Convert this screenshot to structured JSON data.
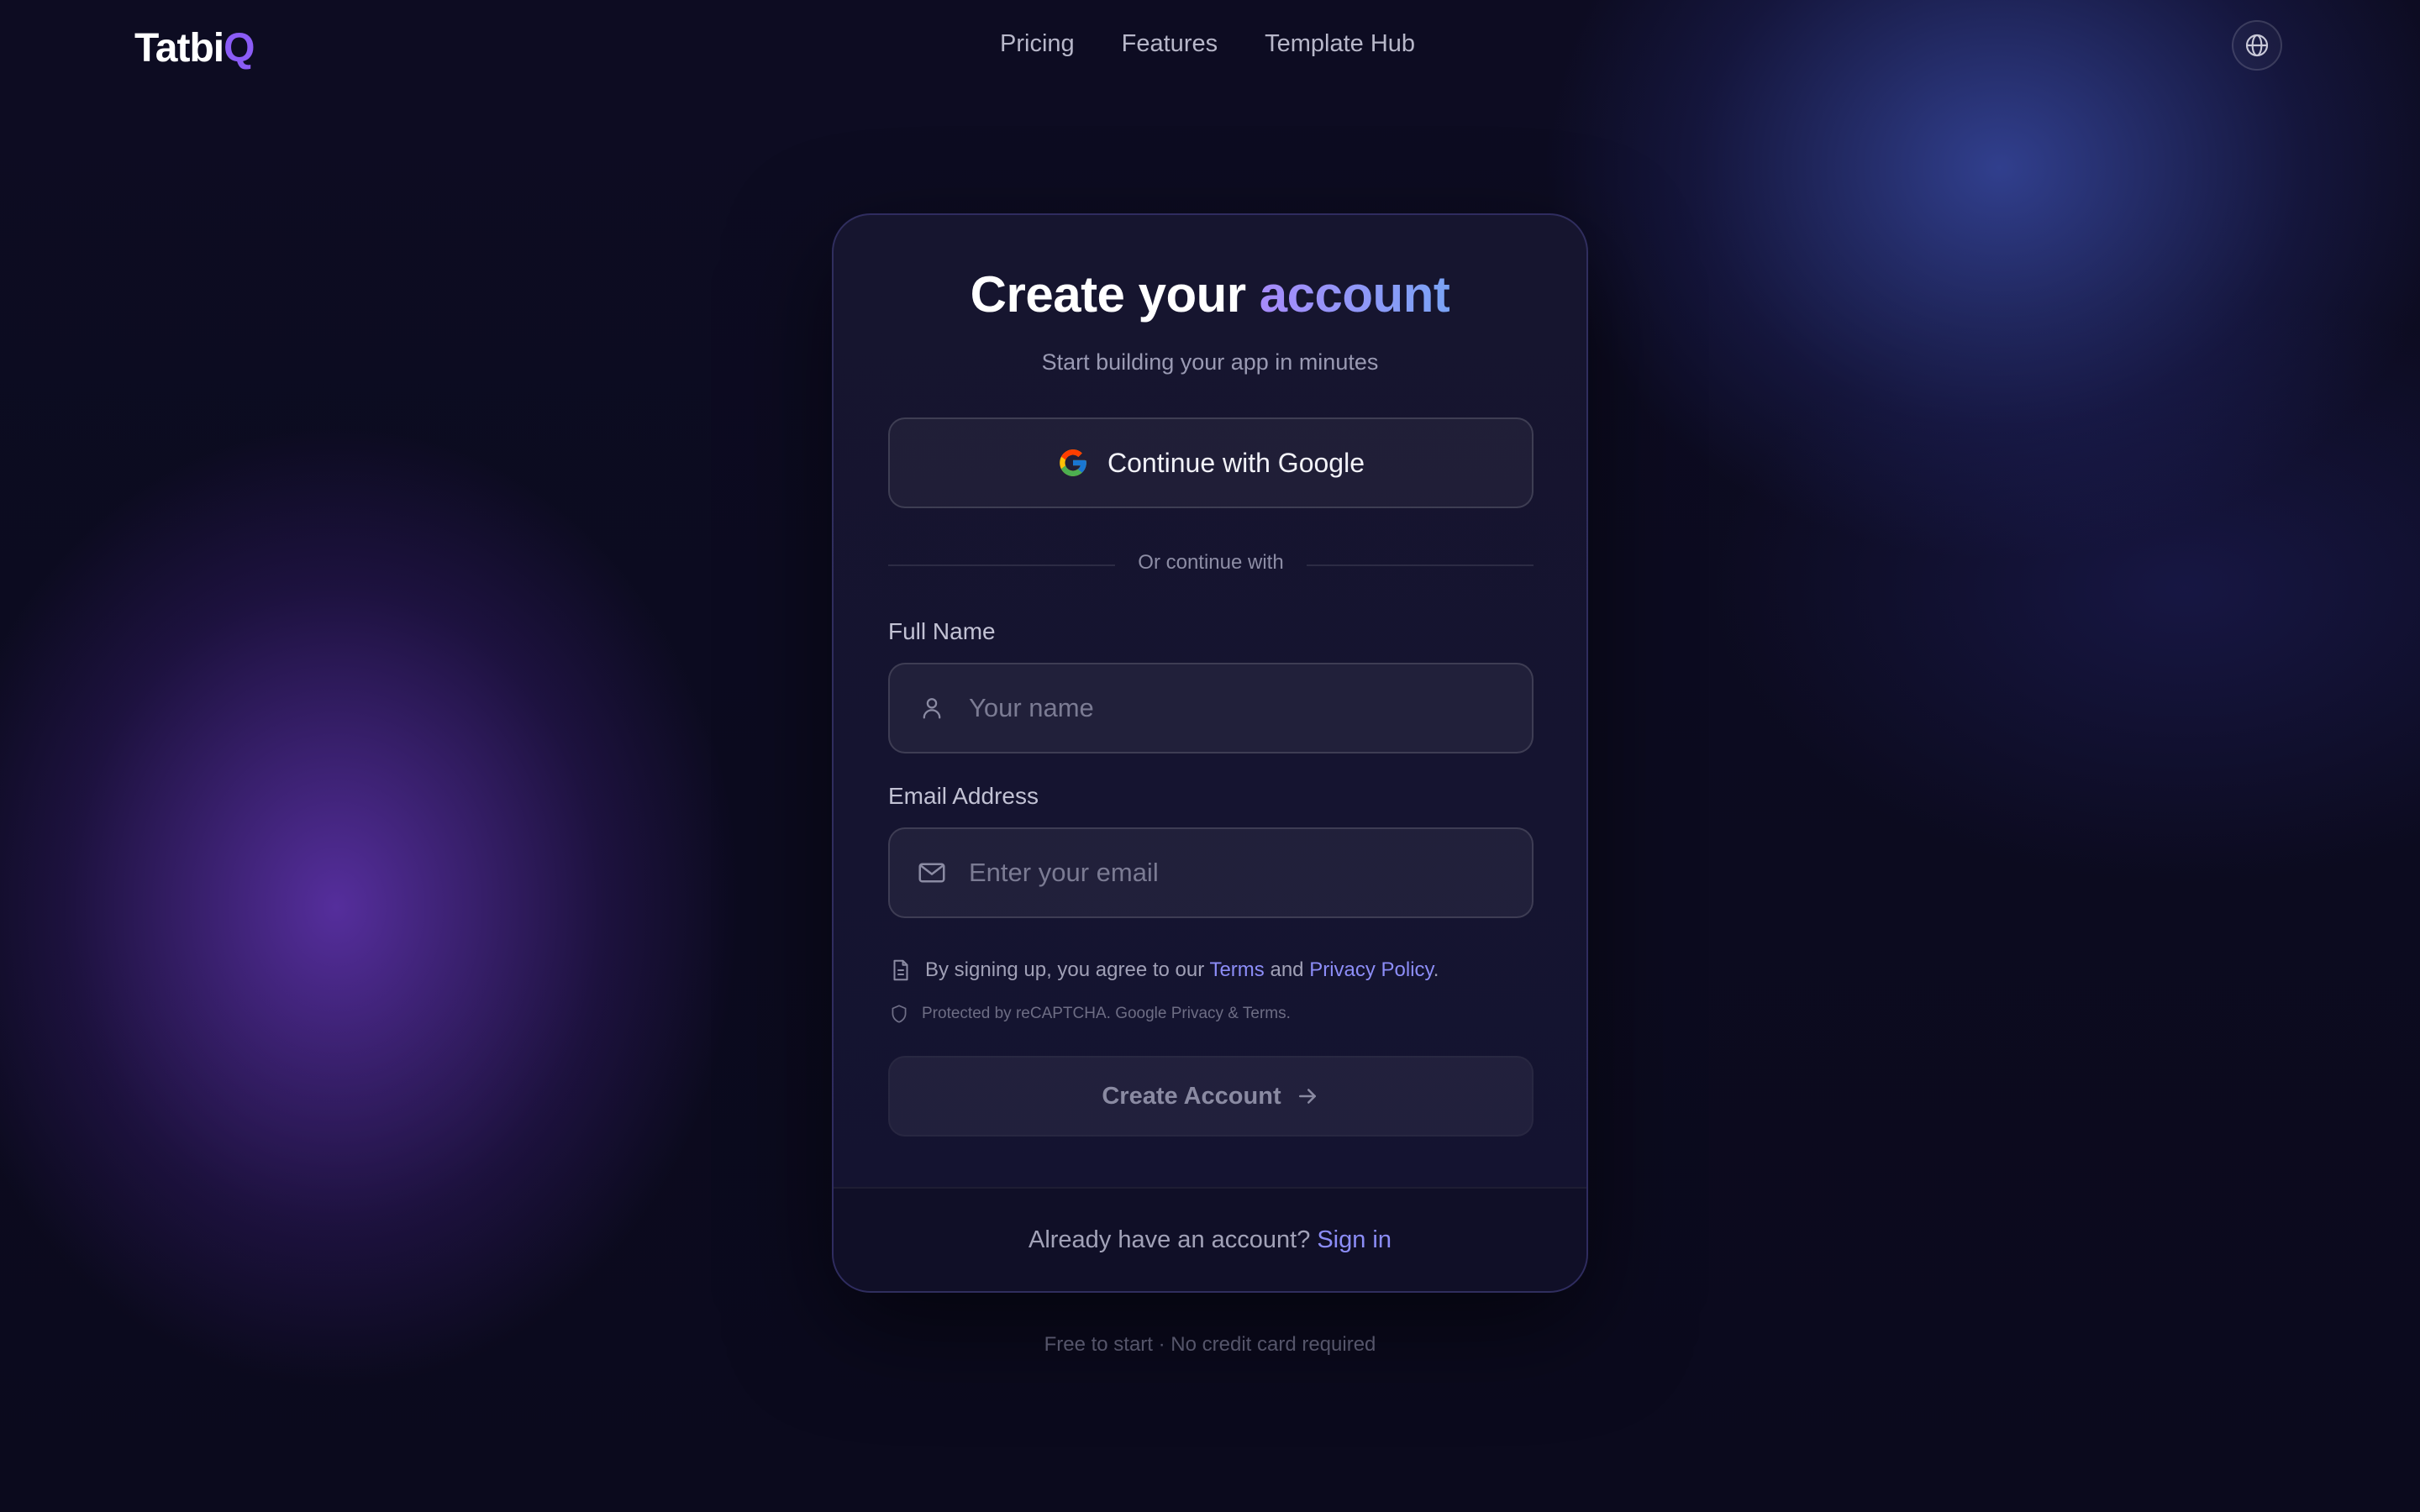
{
  "nav": {
    "logo_main": "Tatbi",
    "logo_accent": "Q",
    "links": [
      "Pricing",
      "Features",
      "Template Hub"
    ],
    "language_icon": "globe-icon"
  },
  "signup": {
    "title_prefix": "Create your",
    "title_accent": "account",
    "subtitle": "Start building your app in minutes",
    "google_button": "Continue with Google",
    "divider": "Or continue with",
    "name_label": "Full Name",
    "name_placeholder": "Your name",
    "email_label": "Email Address",
    "email_placeholder": "Enter your email",
    "terms_prefix": "By signing up, you agree to our",
    "terms_link": "Terms",
    "terms_and": "and",
    "privacy_link": "Privacy Policy",
    "terms_period": ".",
    "recaptcha": "Protected by reCAPTCHA. Google Privacy & Terms.",
    "create_button": "Create Account",
    "signin_prompt": "Already have an account?",
    "signin_link": "Sign in"
  },
  "tagline": "Free to start · No credit card required",
  "colors": {
    "background": "#0c0b1f",
    "accent": "#8c8df7",
    "title_gradient_start": "#a78bfa",
    "title_gradient_end": "#7aa3f5"
  },
  "icons": {
    "google": "google-icon",
    "name_field": "user-icon",
    "email_field": "mail-icon",
    "terms": "document-icon",
    "recaptcha": "shield-icon",
    "create_button": "arrow-right-icon"
  }
}
